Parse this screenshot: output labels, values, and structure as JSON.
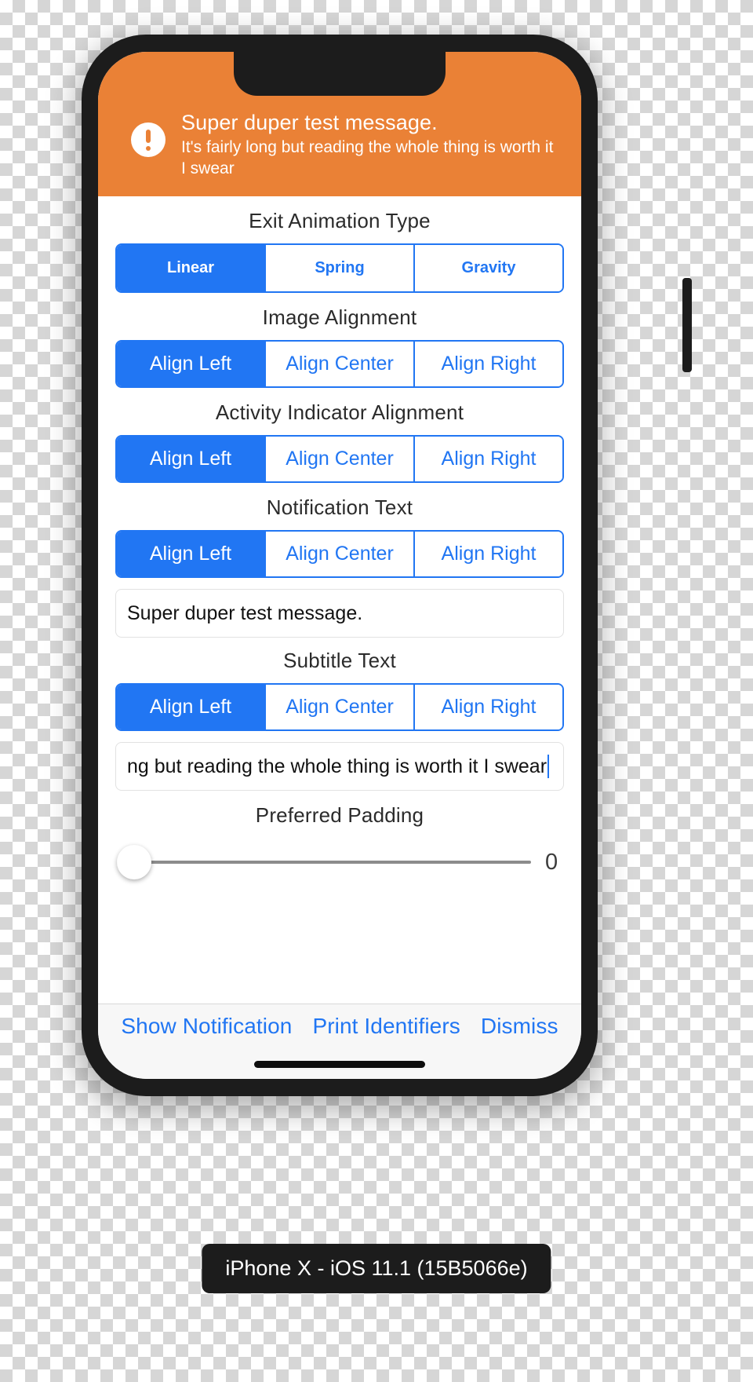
{
  "banner": {
    "icon": "exclamation-circle-icon",
    "title": "Super duper test message.",
    "subtitle": "It's fairly long but reading the whole thing is worth it I swear",
    "background_color": "#ea8136",
    "text_color": "#ffffff"
  },
  "accent_color": "#2176f3",
  "sections": {
    "exit_animation": {
      "label": "Exit Animation Type",
      "options": [
        "Linear",
        "Spring",
        "Gravity"
      ],
      "selected_index": 0
    },
    "image_alignment": {
      "label": "Image Alignment",
      "options": [
        "Align Left",
        "Align Center",
        "Align Right"
      ],
      "selected_index": 0
    },
    "activity_indicator_alignment": {
      "label": "Activity Indicator Alignment",
      "options": [
        "Align Left",
        "Align Center",
        "Align Right"
      ],
      "selected_index": 0
    },
    "notification_text": {
      "label": "Notification Text",
      "options": [
        "Align Left",
        "Align Center",
        "Align Right"
      ],
      "selected_index": 0,
      "field_value": "Super duper test message."
    },
    "subtitle_text": {
      "label": "Subtitle Text",
      "options": [
        "Align Left",
        "Align Center",
        "Align Right"
      ],
      "selected_index": 0,
      "field_value_visible": "ng but reading the whole thing is worth it I swear"
    },
    "preferred_padding": {
      "label": "Preferred Padding",
      "value": "0",
      "slider_percent": 0
    }
  },
  "toolbar": {
    "show_notification": "Show Notification",
    "print_identifiers": "Print Identifiers",
    "dismiss": "Dismiss"
  },
  "device_caption": "iPhone X - iOS 11.1 (15B5066e)"
}
